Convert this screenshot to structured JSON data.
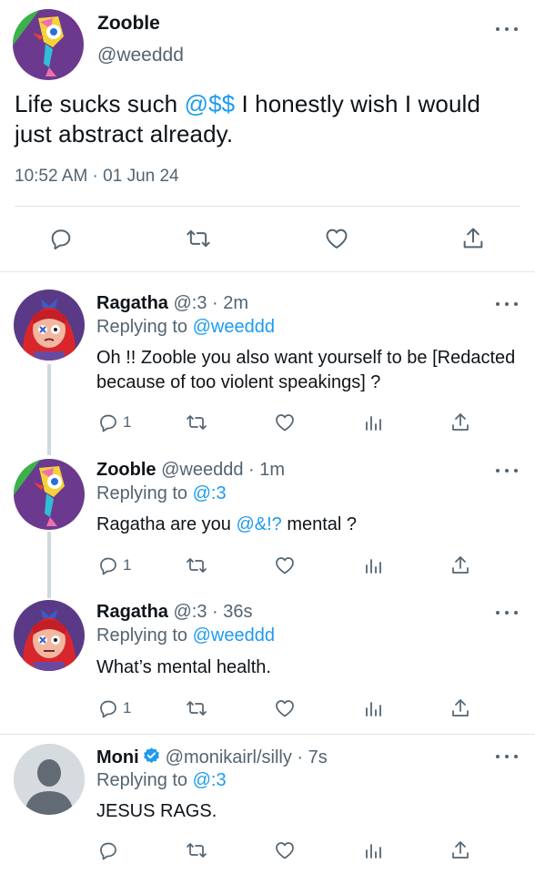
{
  "main_tweet": {
    "name": "Zooble",
    "handle": "@weeddd",
    "text_before": "Life sucks such ",
    "text_mention": "@$$",
    "text_after": " I honestly wish I would just abstract already.",
    "timestamp": "10:52 AM · 01 Jun 24",
    "icons": [
      "reply-icon",
      "retweet-icon",
      "like-icon",
      "share-icon"
    ]
  },
  "replies": [
    {
      "name": "Ragatha",
      "meta": "@:3 · 2m",
      "replying_label": "Replying to",
      "replying_to": "@weeddd",
      "text": "Oh !! Zooble you also want yourself to be [Redacted because of too violent speakings] ?",
      "reply_count": "1"
    },
    {
      "name": "Zooble",
      "meta": "@weeddd · 1m",
      "replying_label": "Replying to",
      "replying_to": "@:3",
      "text_before": "Ragatha are you ",
      "text_mention": "@&!?",
      "text_after": " mental ?",
      "reply_count": "1"
    },
    {
      "name": "Ragatha",
      "meta": "@:3 · 36s",
      "replying_label": "Replying to",
      "replying_to": "@weeddd",
      "text": "What’s mental health.",
      "reply_count": "1"
    },
    {
      "name": "Moni",
      "meta": "@monikairl/silly · 7s",
      "replying_label": "Replying to",
      "replying_to": "@:3",
      "text": "JESUS RAGS.",
      "reply_count": ""
    }
  ],
  "colors": {
    "accent": "#1d9bf0",
    "secondary_text": "#536471",
    "divider": "#e1e6ea"
  }
}
